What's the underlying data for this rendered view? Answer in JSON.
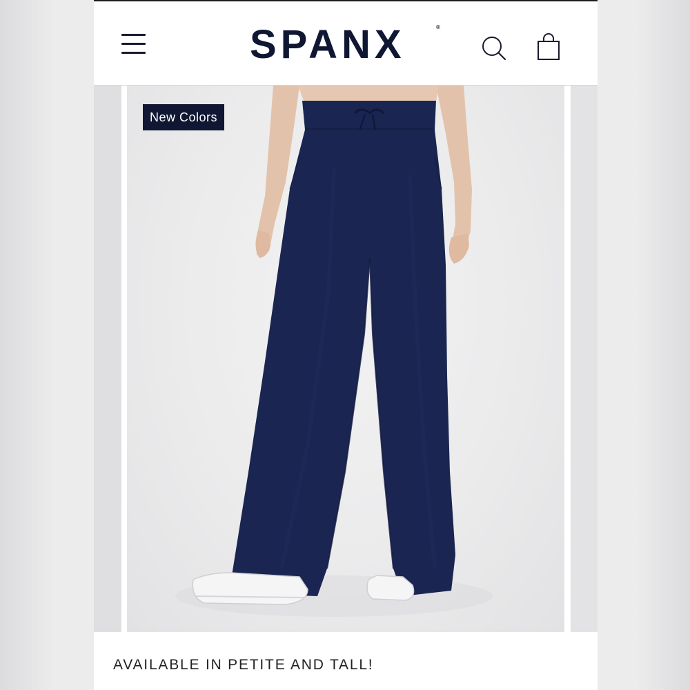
{
  "header": {
    "brand": "SPANX",
    "brand_mark": "®",
    "menu_icon": "hamburger-menu-icon",
    "search_icon": "search-icon",
    "bag_icon": "shopping-bag-icon"
  },
  "product": {
    "badge": "New Colors",
    "image_subject": "navy wide-leg pants",
    "pants_color": "#1b2551"
  },
  "caption": "AVAILABLE IN PETITE AND TALL!"
}
